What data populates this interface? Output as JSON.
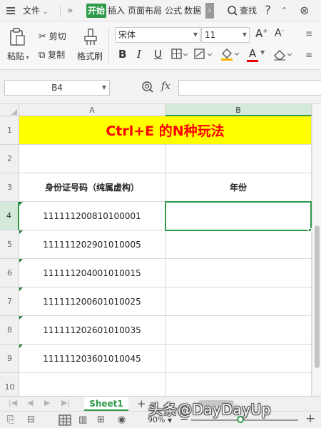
{
  "tabbar": {
    "file": "文件",
    "tabs": [
      "开始",
      "插入",
      "页面布局",
      "公式",
      "数据"
    ],
    "more": "›",
    "search": "查找",
    "help": "?"
  },
  "ribbon": {
    "paste": "粘贴",
    "cut": "剪切",
    "copy": "复制",
    "format_painter": "格式刷",
    "font": "宋体",
    "font_size": "11",
    "bold": "B",
    "italic": "I",
    "underline": "U",
    "font_color_letter": "A"
  },
  "formula_bar": {
    "name_box": "B4",
    "fx": "fx",
    "value": ""
  },
  "grid": {
    "columns": [
      "A",
      "B"
    ],
    "rows": [
      "1",
      "2",
      "3",
      "4",
      "5",
      "6",
      "7",
      "8",
      "9",
      "10"
    ],
    "title": "Ctrl+E 的N种玩法",
    "header_a": "身份证号码（纯属虚构）",
    "header_b": "年份",
    "ids": [
      "111111200810100001",
      "111111202901010005",
      "111111204001010015",
      "111111200601010025",
      "111111202601010035",
      "111111203601010045"
    ],
    "selected_cell": "B4"
  },
  "sheets": {
    "active": "Sheet1",
    "add": "+"
  },
  "status": {
    "zoom": "90%"
  },
  "watermark": "头条@DayDayUp",
  "colors": {
    "accent": "#2e9b4a",
    "title_bg": "#ffff00",
    "title_text": "#ff0000"
  }
}
